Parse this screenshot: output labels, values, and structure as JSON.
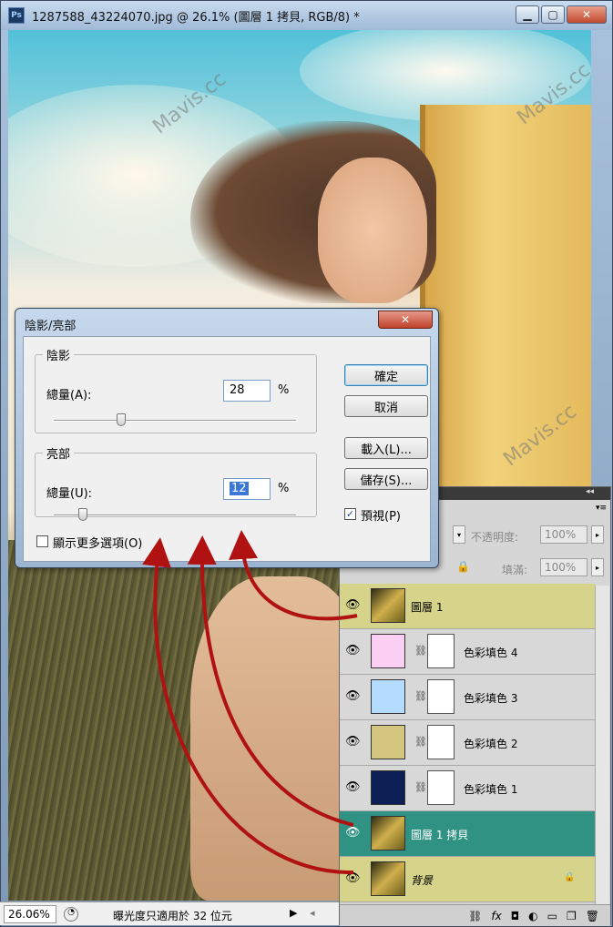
{
  "window": {
    "title": "1287588_43224070.jpg @ 26.1% (圖層 1 拷貝, RGB/8) *",
    "app_icon": "Ps"
  },
  "watermark_text": "Mavis.cc",
  "dialog": {
    "title": "陰影/亮部",
    "shadows": {
      "legend": "陰影",
      "amount_label": "總量(A):",
      "amount_value": "28",
      "unit": "%",
      "slider_fraction": 0.28
    },
    "highlights": {
      "legend": "亮部",
      "amount_label": "總量(U):",
      "amount_value": "12",
      "unit": "%",
      "slider_fraction": 0.12
    },
    "buttons": {
      "ok": "確定",
      "cancel": "取消",
      "load": "載入(L)...",
      "save": "儲存(S)..."
    },
    "preview_label": "預視(P)",
    "preview_checked": true,
    "more_options_label": "顯示更多選項(O)",
    "more_options_checked": false
  },
  "layers_panel": {
    "opacity_label": "不透明度:",
    "opacity_value": "100%",
    "fill_label": "填滿:",
    "fill_value": "100%",
    "layers": [
      {
        "name": "圖層 1",
        "type": "photo",
        "state": "highlighted"
      },
      {
        "name": "色彩填色 4",
        "type": "fill",
        "color": "#fbd0f4",
        "state": "normal"
      },
      {
        "name": "色彩填色 3",
        "type": "fill",
        "color": "#b3dcff",
        "state": "normal"
      },
      {
        "name": "色彩填色 2",
        "type": "fill",
        "color": "#d4c57f",
        "state": "normal"
      },
      {
        "name": "色彩填色 1",
        "type": "fill",
        "color": "#0c1f55",
        "state": "normal"
      },
      {
        "name": "圖層 1 拷貝",
        "type": "photo",
        "state": "selected"
      },
      {
        "name": "背景",
        "type": "photo",
        "state": "highlighted",
        "locked": true
      }
    ]
  },
  "status": {
    "zoom": "26.06%",
    "message": "曝光度只適用於 32 位元"
  },
  "colors": {
    "selected_layer": "#2f9282",
    "highlight_layer": "#d6d48a",
    "arrow": "#b01212"
  }
}
